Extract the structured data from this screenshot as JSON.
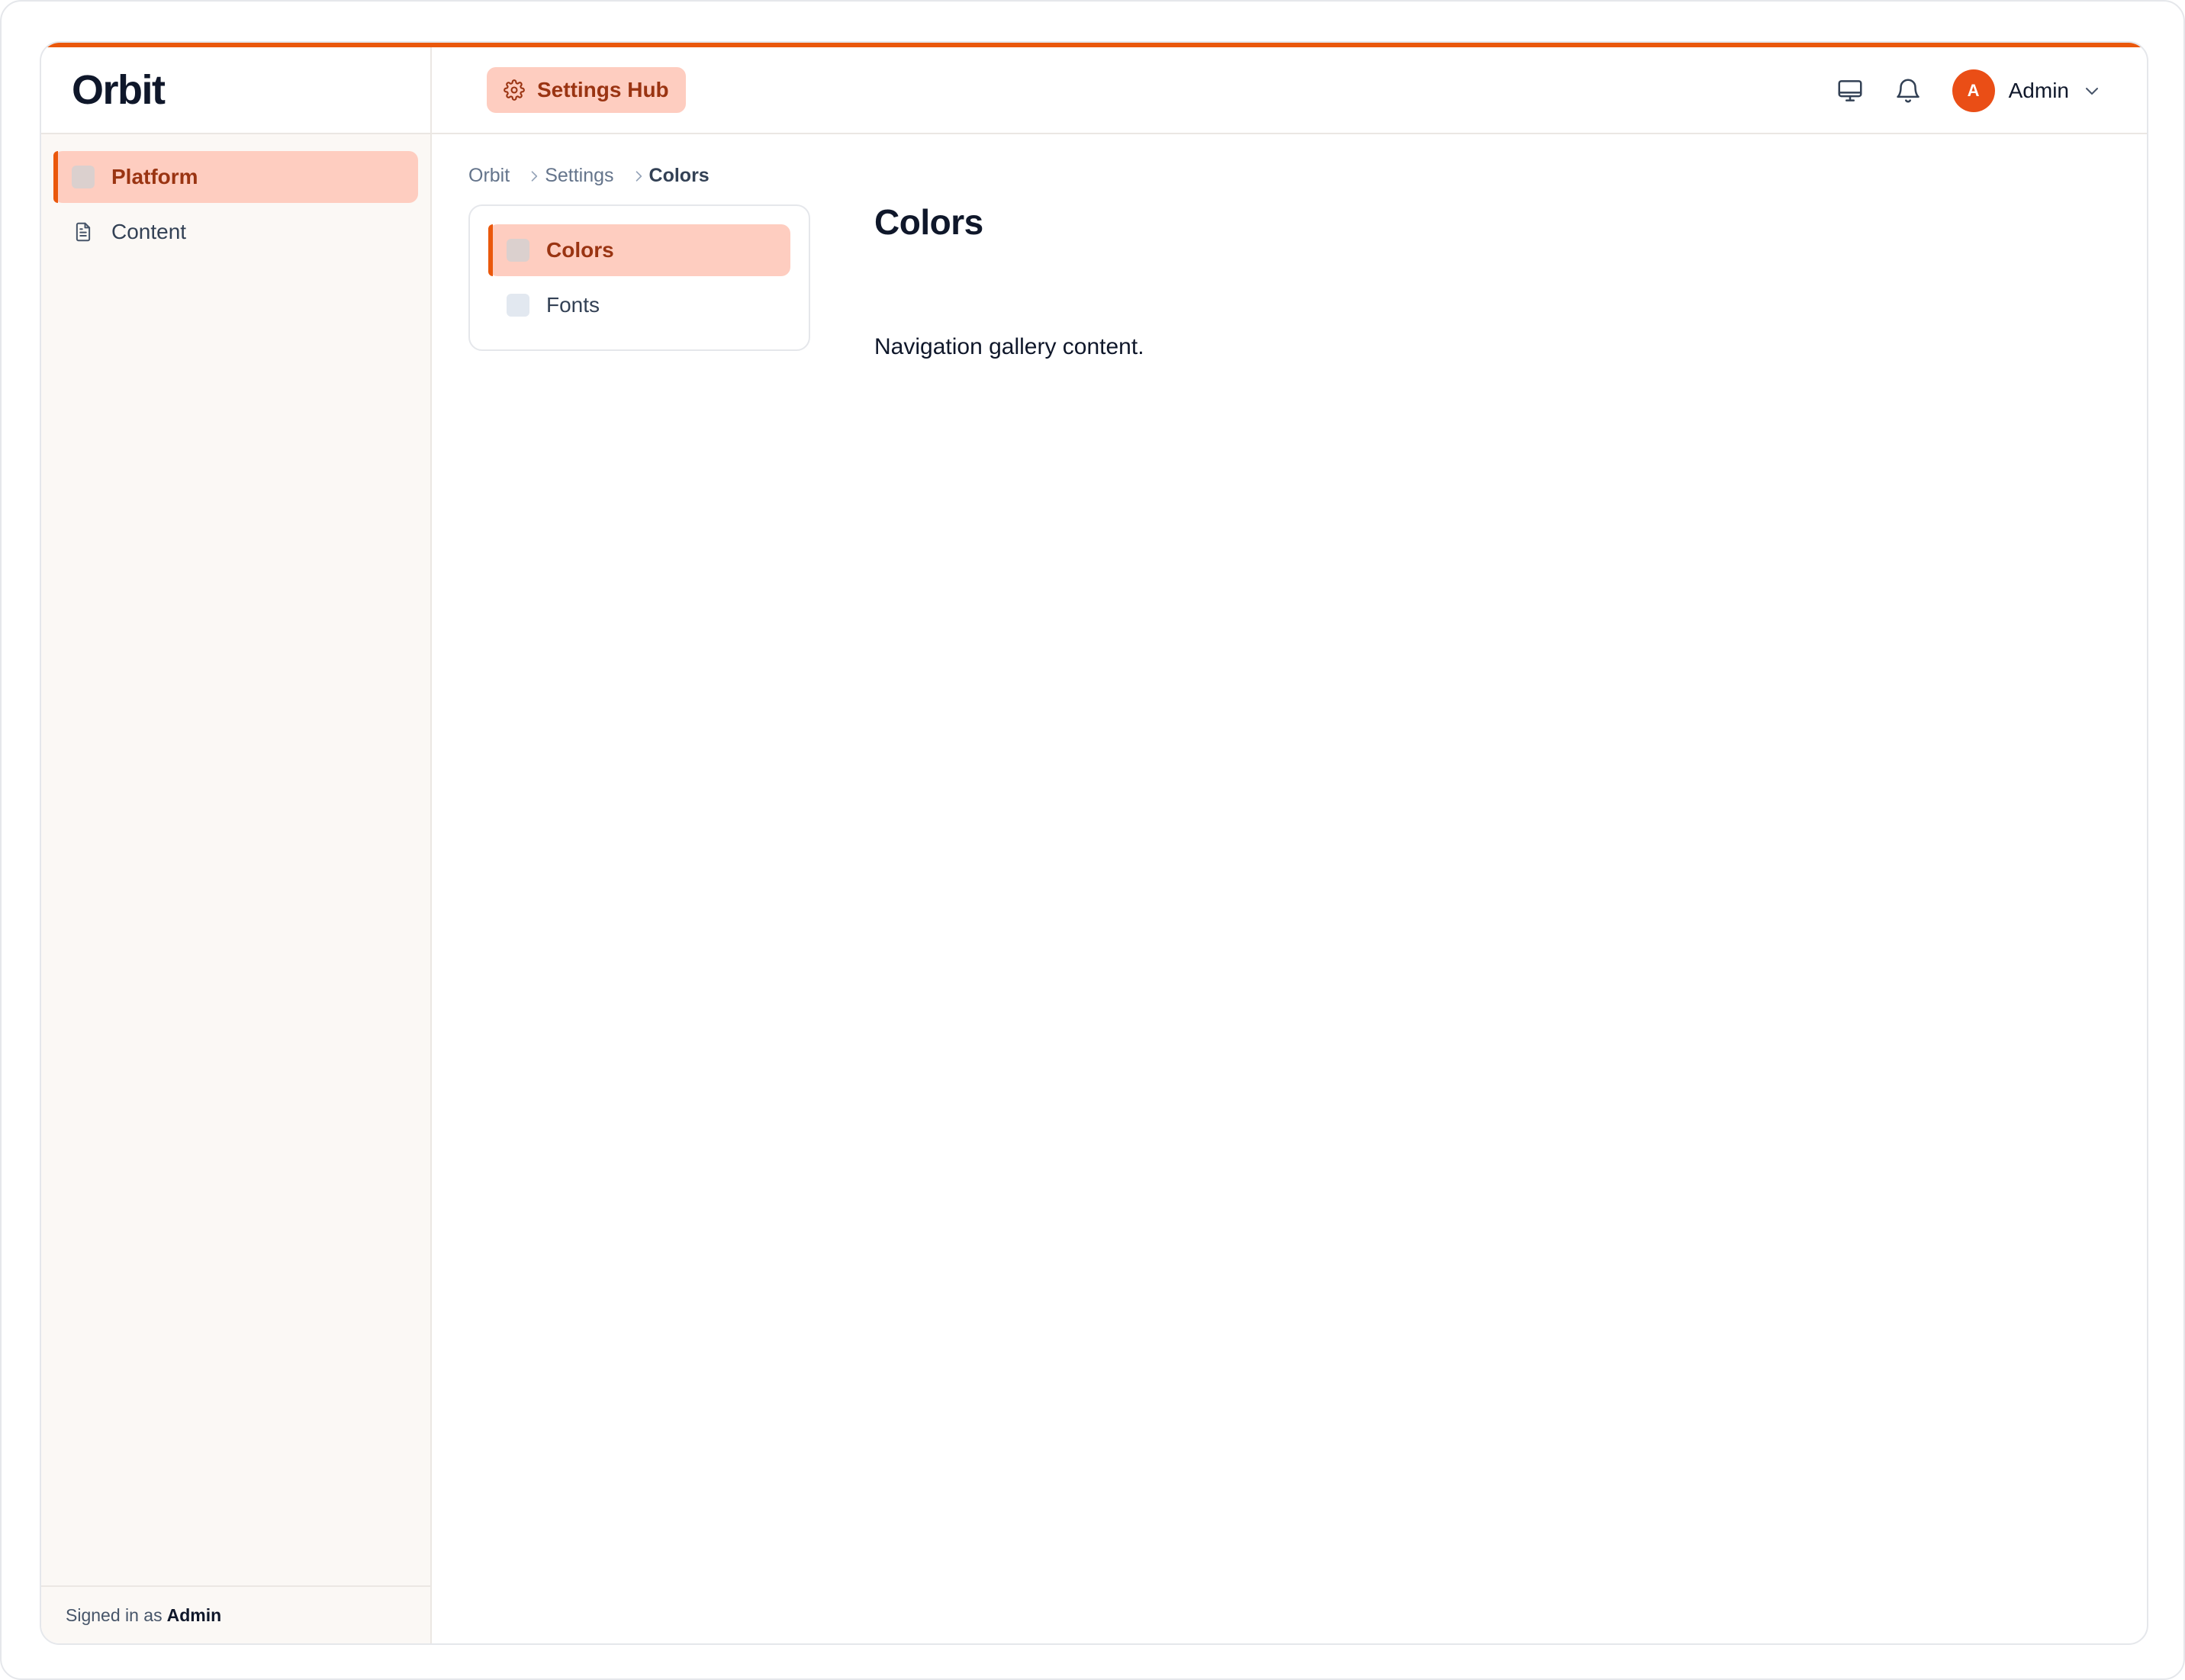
{
  "brand": {
    "name": "Orbit"
  },
  "sidebar": {
    "items": [
      {
        "label": "Platform",
        "active": true,
        "icon": "square-icon"
      },
      {
        "label": "Content",
        "active": false,
        "icon": "document-icon"
      }
    ],
    "footer": {
      "prefix": "Signed in as",
      "user": "Admin"
    }
  },
  "header": {
    "hub_label": "Settings Hub",
    "hub_icon": "gear-icon",
    "icons": [
      "monitor-icon",
      "bell-icon"
    ],
    "avatar_initial": "A",
    "user_name": "Admin"
  },
  "breadcrumb": {
    "items": [
      "Orbit",
      "Settings",
      "Colors"
    ]
  },
  "subnav": {
    "items": [
      {
        "label": "Colors",
        "active": true
      },
      {
        "label": "Fonts",
        "active": false
      }
    ]
  },
  "page": {
    "title": "Colors",
    "description": "Navigation gallery content."
  },
  "colors": {
    "accent": "#ea580c",
    "active_bg": "#fecdc0",
    "active_text": "#9a3412",
    "sidebar_bg": "#fbf8f5"
  }
}
